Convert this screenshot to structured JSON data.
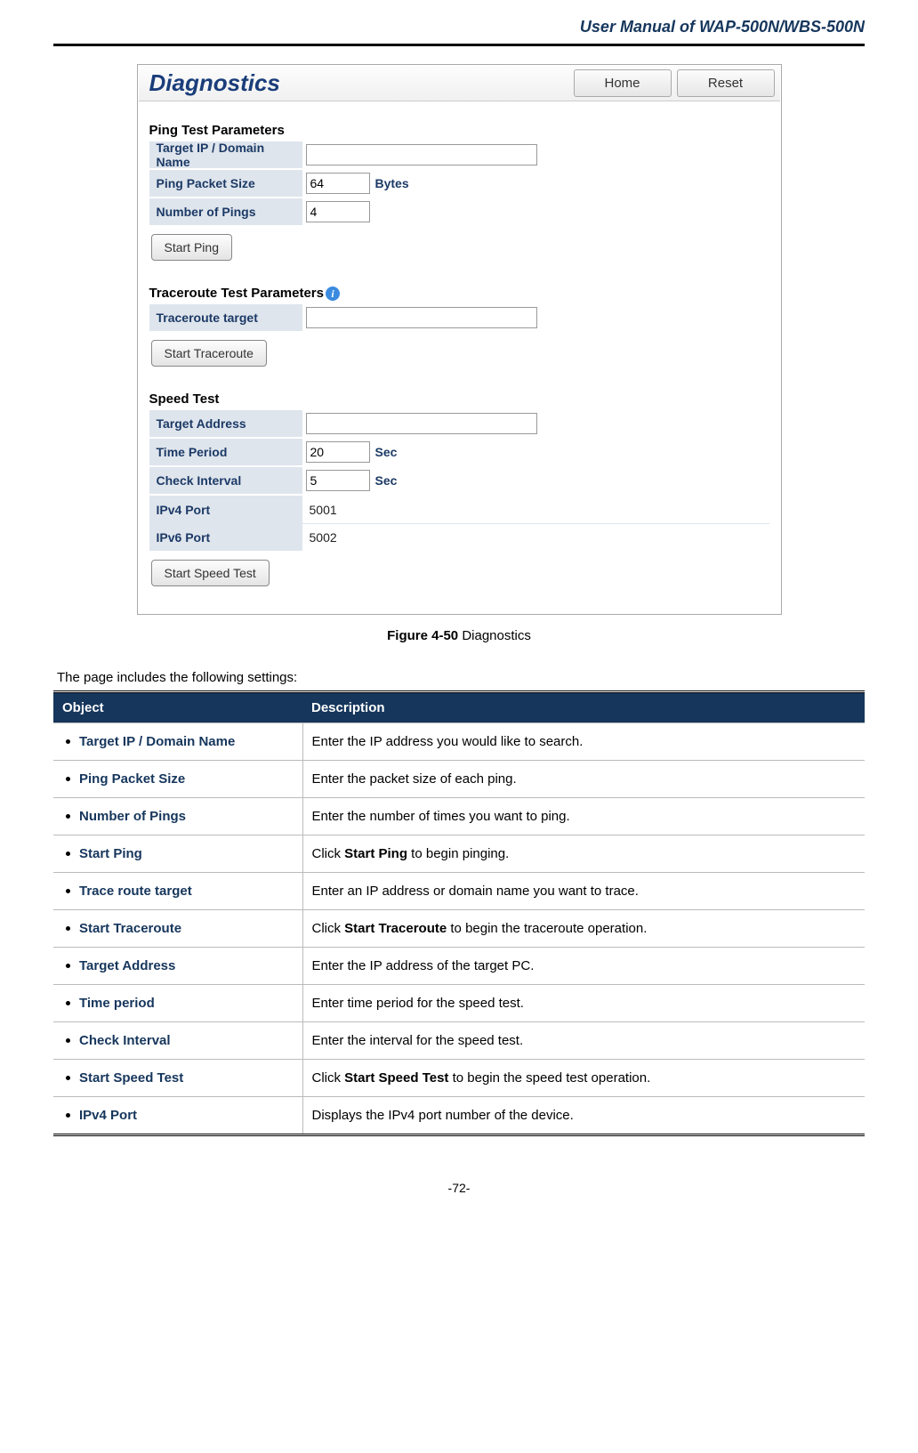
{
  "header": {
    "title": "User  Manual  of  WAP-500N/WBS-500N"
  },
  "screenshot": {
    "title": "Diagnostics",
    "buttons": {
      "home": "Home",
      "reset": "Reset"
    },
    "ping": {
      "heading": "Ping Test Parameters",
      "target_label": "Target IP / Domain Name",
      "target_value": "",
      "size_label": "Ping Packet Size",
      "size_value": "64",
      "size_unit": "Bytes",
      "count_label": "Number of Pings",
      "count_value": "4",
      "start": "Start Ping"
    },
    "trace": {
      "heading": "Traceroute Test Parameters",
      "target_label": "Traceroute target",
      "target_value": "",
      "start": "Start Traceroute"
    },
    "speed": {
      "heading": "Speed Test",
      "addr_label": "Target Address",
      "addr_value": "",
      "period_label": "Time Period",
      "period_value": "20",
      "period_unit": "Sec",
      "interval_label": "Check Interval",
      "interval_value": "5",
      "interval_unit": "Sec",
      "ipv4_label": "IPv4 Port",
      "ipv4_value": "5001",
      "ipv6_label": "IPv6 Port",
      "ipv6_value": "5002",
      "start": "Start Speed Test"
    }
  },
  "caption": {
    "ref": "Figure 4-50",
    "text": " Diagnostics"
  },
  "intro": "The page includes the following settings:",
  "table": {
    "header_obj": "Object",
    "header_desc": "Description",
    "rows": [
      {
        "obj": "Target IP / Domain Name",
        "desc": "Enter the IP address you would like to search."
      },
      {
        "obj": "Ping Packet Size",
        "desc": "Enter the packet size of each ping."
      },
      {
        "obj": "Number of Pings",
        "desc": "Enter the number of times you want to ping."
      },
      {
        "obj": "Start Ping",
        "desc_pre": "Click ",
        "desc_bold": "Start Ping",
        "desc_post": " to begin pinging."
      },
      {
        "obj": "Trace route target",
        "desc": "Enter an IP address or domain name you want to trace."
      },
      {
        "obj": "Start Traceroute",
        "desc_pre": "Click ",
        "desc_bold": "Start Traceroute",
        "desc_post": " to begin the traceroute operation."
      },
      {
        "obj": "Target Address",
        "desc": "Enter the IP address of the target PC."
      },
      {
        "obj": "Time period",
        "desc": "Enter time period for the speed test."
      },
      {
        "obj": "Check Interval",
        "desc": "Enter the interval for the speed test."
      },
      {
        "obj": "Start Speed Test",
        "desc_pre": "Click ",
        "desc_bold": "Start Speed Test",
        "desc_post": " to begin the speed test operation."
      },
      {
        "obj": "IPv4 Port",
        "desc": "Displays the IPv4 port number of the device."
      }
    ]
  },
  "page_number": "-72-"
}
